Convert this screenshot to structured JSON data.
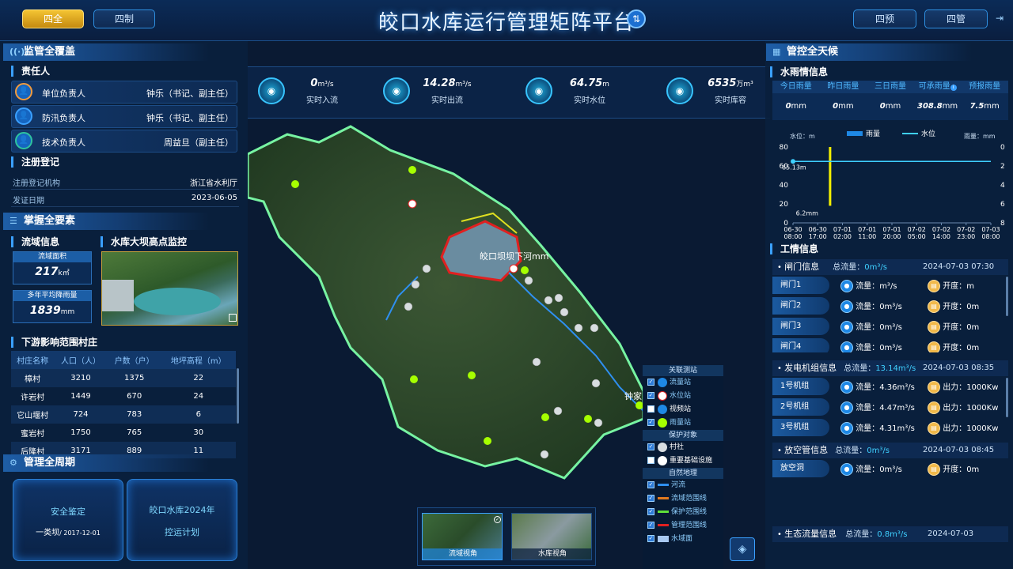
{
  "header": {
    "title": "皎口水库运行管理矩阵平台",
    "btn_siquan": "四全",
    "btn_sizhi": "四制",
    "btn_siyu": "四预",
    "btn_siguan": "四管"
  },
  "left": {
    "jianguan": {
      "title": "监管全覆盖",
      "resp_title": "责任人",
      "persons": [
        {
          "role": "单位负责人",
          "name": "钟乐（书记、副主任）"
        },
        {
          "role": "防汛负责人",
          "name": "钟乐（书记、副主任）"
        },
        {
          "role": "技术负责人",
          "name": "周益旦（副主任）"
        }
      ],
      "reg_title": "注册登记",
      "reg_org_label": "注册登记机构",
      "reg_org": "浙江省水利厅",
      "reg_date_label": "发证日期",
      "reg_date": "2023-06-05"
    },
    "zhangwo": {
      "title": "掌握全要素",
      "basin_title": "流域信息",
      "monitor_title": "水库大坝高点监控",
      "area_label": "流域面积",
      "area_val": "217",
      "area_unit": "k㎡",
      "rain_label": "多年平均降雨量",
      "rain_val": "1839",
      "rain_unit": "mm",
      "village_title": "下游影响范围村庄",
      "village_headers": [
        "村庄名称",
        "人口（人）",
        "户数（户）",
        "地坪高程（m）"
      ],
      "villages": [
        [
          "樟村",
          "3210",
          "1375",
          "22"
        ],
        [
          "许岩村",
          "1449",
          "670",
          "24"
        ],
        [
          "它山堰村",
          "724",
          "783",
          "6"
        ],
        [
          "蜜岩村",
          "1750",
          "765",
          "30"
        ],
        [
          "后隆村",
          "3171",
          "889",
          "11"
        ]
      ]
    },
    "guanli": {
      "title": "管理全周期",
      "card1_title": "安全鉴定",
      "card1_sub": "一类坝",
      "card1_date": "/ 2017-12-01",
      "card2_line1": "皎口水库2024年",
      "card2_line2": "控运计划"
    }
  },
  "metrics": [
    {
      "value": "0",
      "unit": "m³/s",
      "label": "实时入流",
      "icon": "inflow-icon"
    },
    {
      "value": "14.28",
      "unit": "m³/s",
      "label": "实时出流",
      "icon": "outflow-icon"
    },
    {
      "value": "64.75",
      "unit": "m",
      "label": "实时水位",
      "icon": "water-level-icon"
    },
    {
      "value": "6535",
      "unit": "万m³",
      "label": "实时库容",
      "icon": "storage-icon"
    }
  ],
  "map": {
    "dam_label": "皎口坝坝下河mm",
    "town_label": "钟家"
  },
  "legend": {
    "sec1": "关联测站",
    "items1": [
      {
        "label": "流量站",
        "on": true
      },
      {
        "label": "水位站",
        "on": true
      },
      {
        "label": "视频站",
        "on": false
      },
      {
        "label": "雨量站",
        "on": true
      }
    ],
    "sec2": "保护对象",
    "items2": [
      {
        "label": "村社",
        "on": true
      },
      {
        "label": "重要基础设施",
        "on": false
      }
    ],
    "sec3": "自然地理",
    "items3": [
      {
        "label": "河流",
        "on": true,
        "color": "#2f8ff0"
      },
      {
        "label": "流域范围线",
        "on": true,
        "color": "#e07a1f"
      },
      {
        "label": "保护范围线",
        "on": true,
        "color": "#5ee03a"
      },
      {
        "label": "管理范围线",
        "on": true,
        "color": "#e02020"
      },
      {
        "label": "水域面",
        "on": true,
        "color": "#a8c8f0"
      }
    ]
  },
  "views": {
    "basin": "流域视角",
    "reservoir": "水库视角"
  },
  "right": {
    "title": "管控全天候",
    "rain_title": "水雨情信息",
    "rain_headers": [
      "今日雨量",
      "昨日雨量",
      "三日雨量",
      "可承雨量",
      "预报雨量"
    ],
    "rain_values": [
      {
        "v": "0",
        "u": "mm"
      },
      {
        "v": "0",
        "u": "mm"
      },
      {
        "v": "0",
        "u": "mm"
      },
      {
        "v": "308.8",
        "u": "mm"
      },
      {
        "v": "7.5",
        "u": "mm"
      }
    ],
    "chart_left_label": "水位：m",
    "chart_right_label": "雨量：mm",
    "legend_rain": "雨量",
    "legend_level": "水位",
    "work_title": "工情信息",
    "gate": {
      "title": "闸门信息",
      "total_label": "总流量：",
      "total": "0m³/s",
      "time": "2024-07-03 07:30",
      "rows": [
        {
          "name": "闸门1",
          "flow": "流量：",
          "flow_v": "m³/s",
          "open": "开度：",
          "open_v": "m"
        },
        {
          "name": "闸门2",
          "flow": "流量：",
          "flow_v": "0m³/s",
          "open": "开度：",
          "open_v": "0m"
        },
        {
          "name": "闸门3",
          "flow": "流量：",
          "flow_v": "0m³/s",
          "open": "开度：",
          "open_v": "0m"
        },
        {
          "name": "闸门4",
          "flow": "流量：",
          "flow_v": "0m³/s",
          "open": "开度：",
          "open_v": "0m"
        }
      ]
    },
    "gen": {
      "title": "发电机组信息",
      "total_label": "总流量：",
      "total": "13.14m³/s",
      "time": "2024-07-03 08:35",
      "rows": [
        {
          "name": "1号机组",
          "flow": "流量：",
          "flow_v": "4.36m³/s",
          "out": "出力：",
          "out_v": "1000Kw"
        },
        {
          "name": "2号机组",
          "flow": "流量：",
          "flow_v": "4.47m³/s",
          "out": "出力：",
          "out_v": "1000Kw"
        },
        {
          "name": "3号机组",
          "flow": "流量：",
          "flow_v": "4.31m³/s",
          "out": "出力：",
          "out_v": "1000Kw"
        }
      ]
    },
    "empty": {
      "title": "放空管信息",
      "total_label": "总流量：",
      "total": "0m³/s",
      "time": "2024-07-03 08:45",
      "rows": [
        {
          "name": "放空洞",
          "flow": "流量：",
          "flow_v": "0m³/s",
          "open": "开度：",
          "open_v": "0m"
        }
      ]
    },
    "eco": {
      "title": "生态流量信息",
      "total_label": "总流量：",
      "total": "0.8m³/s",
      "time": "2024-07-03"
    }
  },
  "chart_data": {
    "type": "line",
    "x": [
      "06-30 08:00",
      "06-30 17:00",
      "07-01 02:00",
      "07-01 11:00",
      "07-01 20:00",
      "07-02 05:00",
      "07-02 14:00",
      "07-02 23:00",
      "07-03 08:00"
    ],
    "series": [
      {
        "name": "水位",
        "values": [
          64.75,
          64.75,
          64.75,
          64.75,
          64.75,
          64.75,
          64.75,
          64.75,
          64.75
        ]
      },
      {
        "name": "雨量",
        "values": [
          0,
          6.2,
          0,
          0,
          0,
          0,
          0,
          0,
          0
        ]
      }
    ],
    "point_labels": [
      "65.13m",
      "6.2mm"
    ],
    "xlabel": "",
    "ylabel": "水位：m",
    "y2label": "雨量：mm",
    "ylim": [
      0,
      80
    ],
    "y2lim": [
      0,
      8
    ],
    "y_ticks": [
      "0",
      "20",
      "40",
      "60",
      "80"
    ],
    "y2_ticks": [
      "8",
      "6",
      "4",
      "2",
      "0"
    ],
    "legend": "top"
  }
}
